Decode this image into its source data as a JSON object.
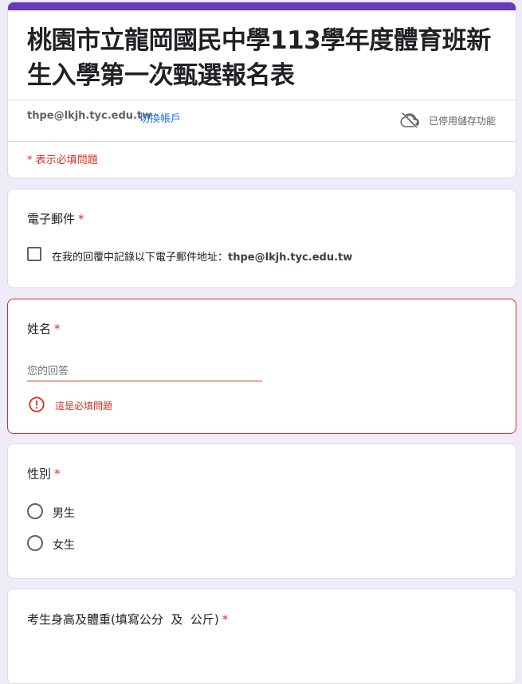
{
  "form": {
    "title": "桃園市立龍岡國民中學113學年度體育班新生入學第一次甄選報名表",
    "account_email": "thpe@lkjh.tyc.edu.tw",
    "switch_account": "切換帳戶",
    "saving_status": "已停用儲存功能",
    "required_note": "* 表示必填問題",
    "accent_color": "#673ab7",
    "error_color": "#d93025"
  },
  "questions": {
    "email": {
      "title": "電子郵件",
      "required_star": "*",
      "checkbox_label": "在我的回覆中記錄以下電子郵件地址：",
      "checkbox_email": "thpe@lkjh.tyc.edu.tw"
    },
    "name": {
      "title": "姓名",
      "required_star": "*",
      "placeholder": "您的回答",
      "error": "這是必填問題"
    },
    "gender": {
      "title": "性別",
      "required_star": "*",
      "options": [
        "男生",
        "女生"
      ]
    },
    "height_weight": {
      "title": "考生身高及體重(填寫公分  及  公斤)",
      "required_star": "*"
    }
  },
  "icons": {
    "saving": "cloud-off-icon",
    "error": "error-icon"
  }
}
